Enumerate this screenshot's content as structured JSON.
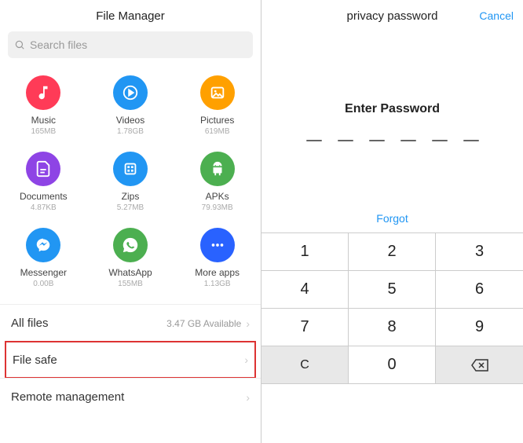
{
  "left": {
    "title": "File Manager",
    "search_placeholder": "Search files",
    "categories": [
      {
        "name": "Music",
        "size": "165MB",
        "color": "#FF3B57",
        "icon": "music"
      },
      {
        "name": "Videos",
        "size": "1.78GB",
        "color": "#2196F3",
        "icon": "play"
      },
      {
        "name": "Pictures",
        "size": "619MB",
        "color": "#FFA000",
        "icon": "image"
      },
      {
        "name": "Documents",
        "size": "4.87KB",
        "color": "#8E44E5",
        "icon": "doc"
      },
      {
        "name": "Zips",
        "size": "5.27MB",
        "color": "#2196F3",
        "icon": "zip"
      },
      {
        "name": "APKs",
        "size": "79.93MB",
        "color": "#4CAF50",
        "icon": "android"
      },
      {
        "name": "Messenger",
        "size": "0.00B",
        "color": "#2196F3",
        "icon": "messenger"
      },
      {
        "name": "WhatsApp",
        "size": "155MB",
        "color": "#4CAF50",
        "icon": "whatsapp"
      },
      {
        "name": "More apps",
        "size": "1.13GB",
        "color": "#2962FF",
        "icon": "more"
      }
    ],
    "list": {
      "all_files": "All files",
      "available": "3.47 GB Available",
      "file_safe": "File safe",
      "remote": "Remote management"
    }
  },
  "right": {
    "title": "privacy password",
    "cancel": "Cancel",
    "prompt": "Enter Password",
    "digits": 6,
    "forgot": "Forgot",
    "keys": [
      "1",
      "2",
      "3",
      "4",
      "5",
      "6",
      "7",
      "8",
      "9",
      "C",
      "0",
      "⌫"
    ]
  }
}
